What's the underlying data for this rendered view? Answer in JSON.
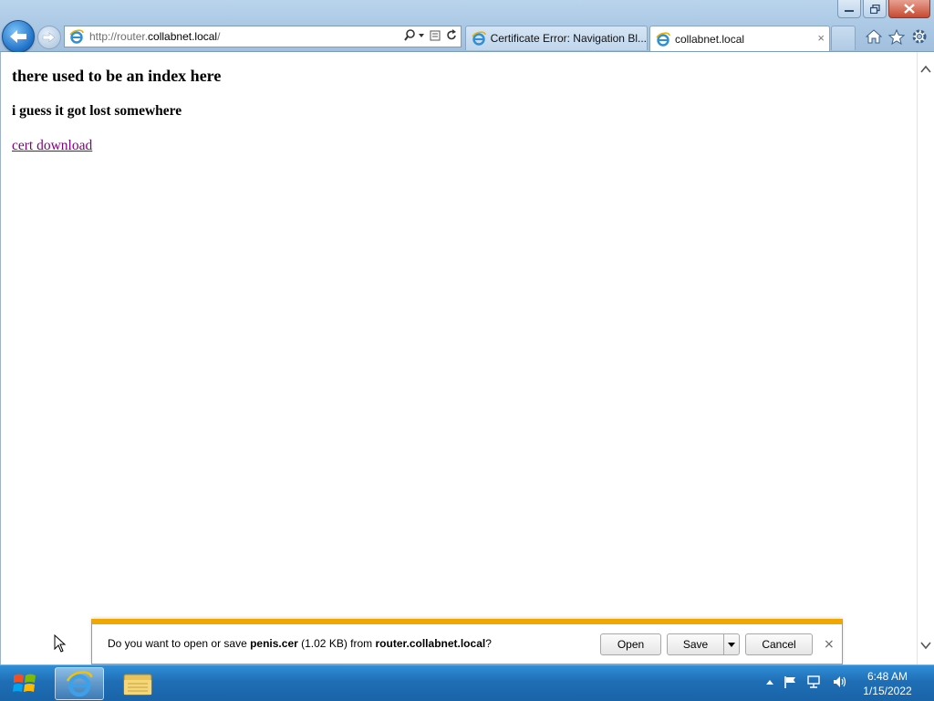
{
  "browser": {
    "address": {
      "url_prefix": "http://router.",
      "url_domain": "collabnet.local",
      "url_suffix": "/"
    },
    "tabs": [
      {
        "label": "Certificate Error: Navigation Bl..."
      },
      {
        "label": "collabnet.local",
        "close": "×"
      }
    ]
  },
  "page": {
    "heading": "there used to be an index here",
    "subheading": "i guess it got lost somewhere",
    "link": "cert download"
  },
  "download_bar": {
    "msg_prefix": "Do you want to open or save ",
    "filename": "penis.cer",
    "size": " (1.02 KB) from ",
    "source": "router.collabnet.local",
    "msg_suffix": "?",
    "open_label": "Open",
    "save_label": "Save",
    "cancel_label": "Cancel",
    "close": "×"
  },
  "taskbar": {
    "time": "6:48 AM",
    "date": "1/15/2022"
  },
  "colors": {
    "link_visited": "#800080",
    "notification_accent": "#f0a800",
    "taskbar": "#1f6eb5"
  }
}
